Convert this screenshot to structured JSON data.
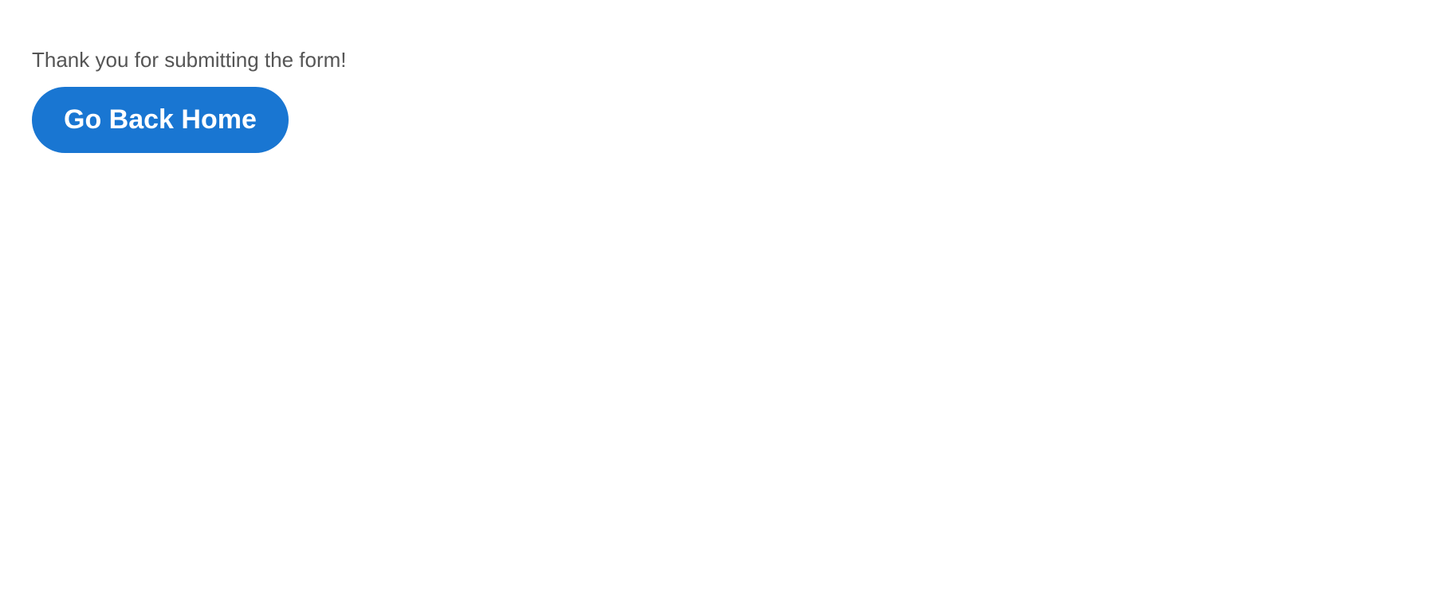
{
  "message": "Thank you for submitting the form!",
  "button_label": "Go Back Home"
}
